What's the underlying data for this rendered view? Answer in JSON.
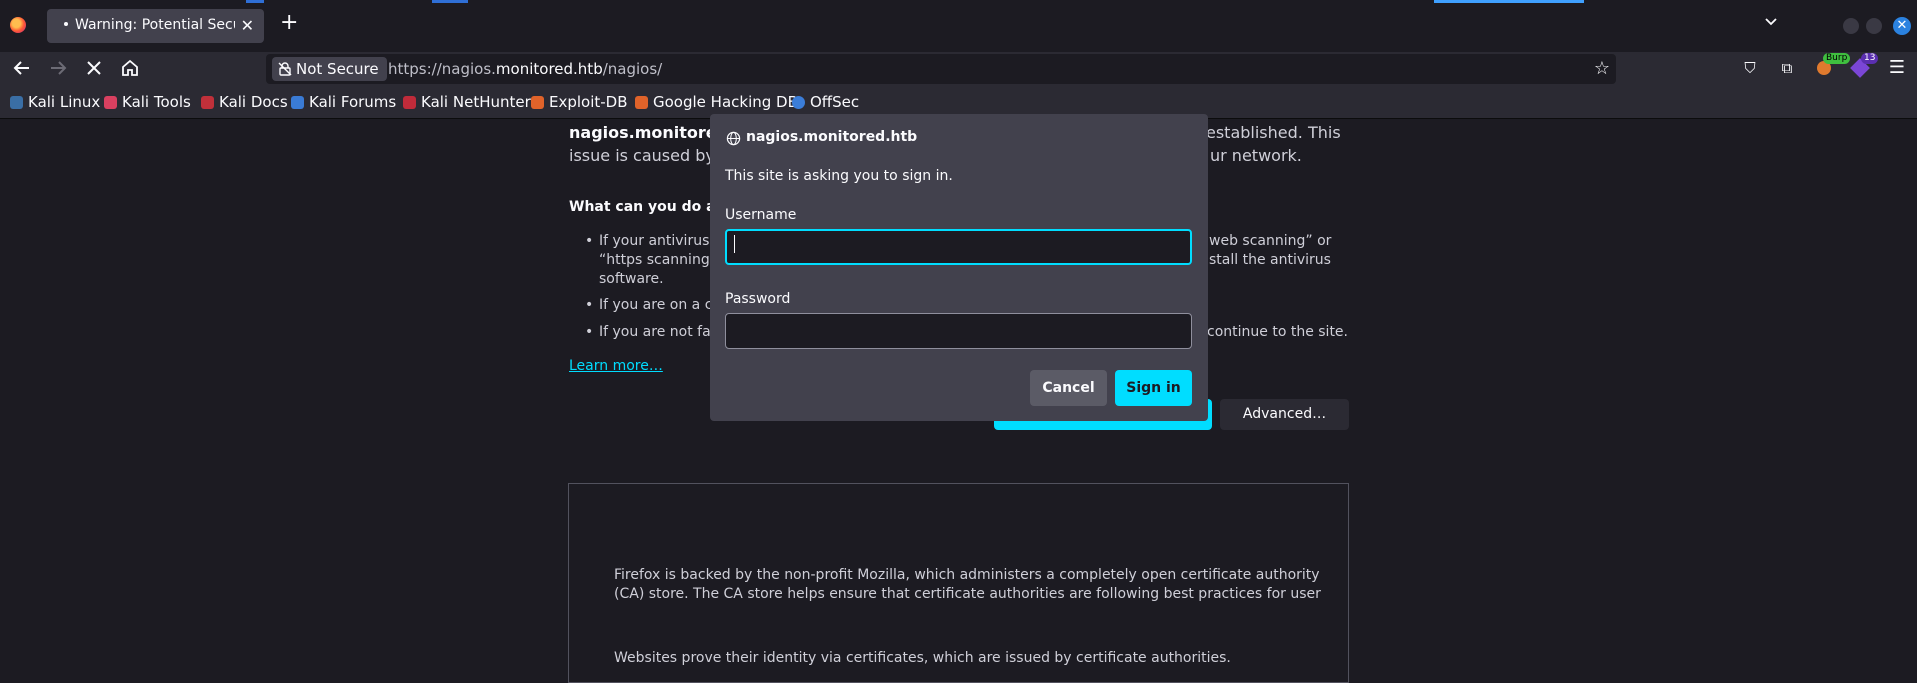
{
  "tabs": [
    {
      "title": "Warning: Potential Security Risk Ahead",
      "active": true
    }
  ],
  "nav": {
    "security_label": "Not Secure",
    "url_prefix": "https://nagios.",
    "url_domain": "monitored.htb",
    "url_path": "/nagios/"
  },
  "extensions": {
    "burp_badge": "Burp",
    "count_badge": "13"
  },
  "bookmarks": [
    "Kali Linux",
    "Kali Tools",
    "Kali Docs",
    "Kali Forums",
    "Kali NetHunter",
    "Exploit-DB",
    "Google Hacking DB",
    "OffSec"
  ],
  "page": {
    "line1_left": "nagios.monitored",
    "line1_right": "established. This",
    "line2_left": "issue is caused by",
    "line2_right": "ur network.",
    "heading": "What can you do abo",
    "bullet1_left": "If your antivirus s",
    "bullet1_right": "web scanning” or",
    "bullet1b_left": "“https scanning”",
    "bullet1b_right": "stall the antivirus",
    "bullet1c": "software.",
    "bullet2_left": "If you are on a co",
    "bullet3_left": "If you are not fam",
    "bullet3_right": "continue to the site.",
    "learn_more": "Learn more…",
    "advanced_button": "Advanced…",
    "cert_p1": "Websites prove their identity via certificates, which are issued by certificate authorities.",
    "cert_p2a": "Firefox is backed by the non-profit Mozilla, which administers a completely open certificate authority",
    "cert_p2b": "(CA) store. The CA store helps ensure that certificate authorities are following best practices for user"
  },
  "dialog": {
    "host": "nagios.monitored.htb",
    "message": "This site is asking you to sign in.",
    "username_label": "Username",
    "username_value": "",
    "password_label": "Password",
    "password_value": "",
    "cancel_label": "Cancel",
    "signin_label": "Sign in"
  },
  "colors": {
    "accent": "#00ddff",
    "toolbar": "#2b2a33",
    "background": "#1c1b22",
    "dialog": "#42414d"
  }
}
